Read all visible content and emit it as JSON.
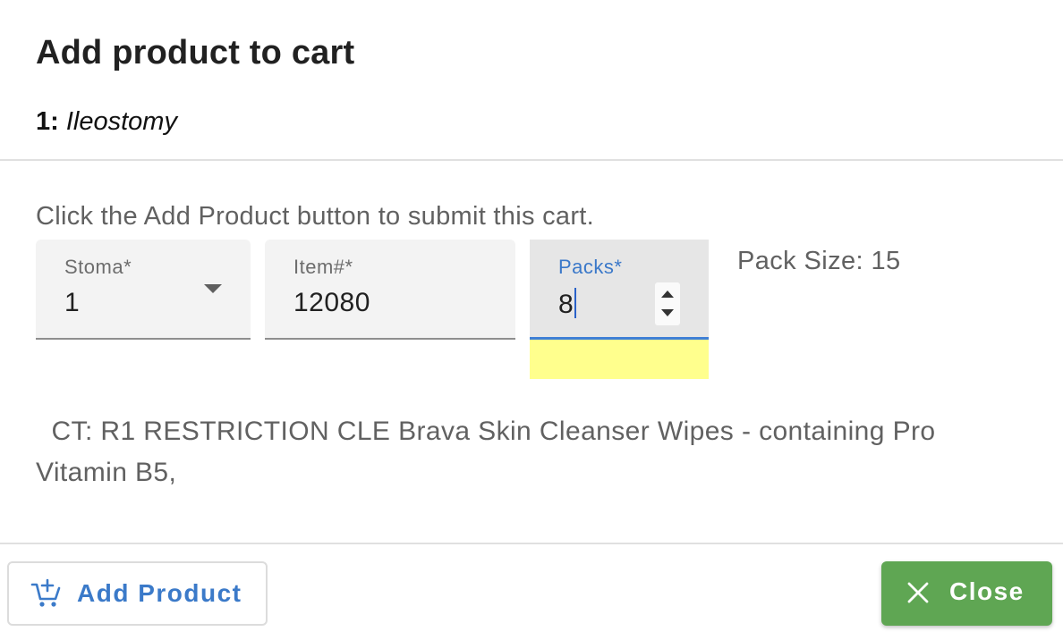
{
  "dialog": {
    "title": "Add product to cart",
    "subtitle_number": "1:",
    "subtitle_name": "Ileostomy"
  },
  "instructions": "Click the Add Product button to submit this cart.",
  "fields": {
    "stoma": {
      "label": "Stoma*",
      "value": "1",
      "icon": "chevron-down-icon"
    },
    "item": {
      "label": "Item#*",
      "value": "12080"
    },
    "packs": {
      "label": "Packs*",
      "value": "8",
      "icon": "spinner-arrows-icon"
    }
  },
  "pack_size": "Pack Size: 15",
  "description": "  CT: R1 RESTRICTION CLE Brava Skin Cleanser Wipes - containing Pro Vitamin B5,",
  "buttons": {
    "add_product": {
      "label": "Add Product",
      "icon": "add-to-cart-icon"
    },
    "close": {
      "label": "Close",
      "icon": "close-icon"
    }
  },
  "colors": {
    "accent_blue": "#3b7ac9",
    "close_green": "#5fa653",
    "highlight_yellow": "#ffff8d",
    "focus_underline": "#3f7fd6"
  }
}
